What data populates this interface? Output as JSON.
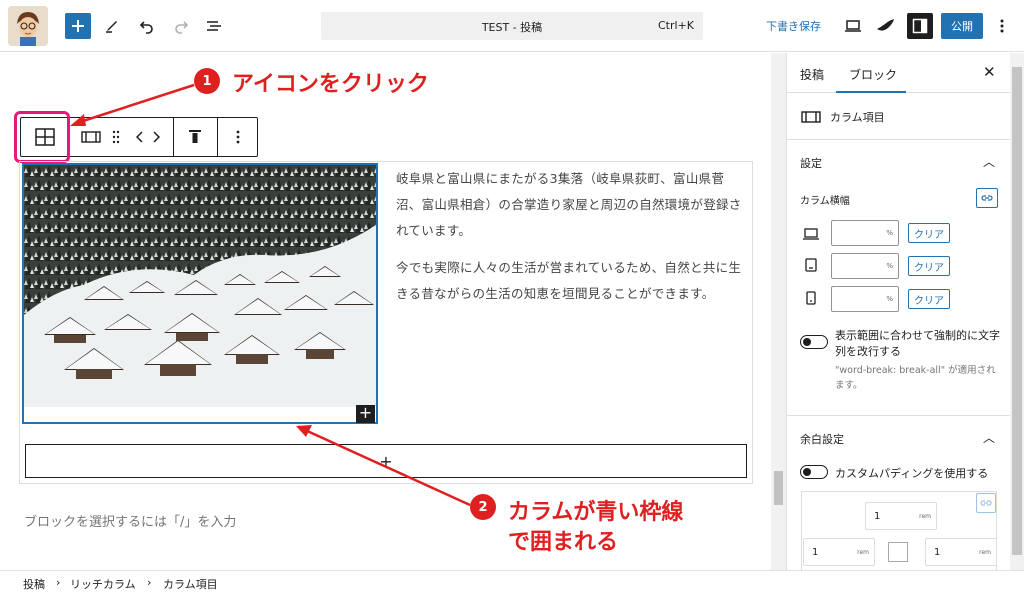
{
  "header": {
    "command_title": "TEST - 投稿",
    "command_shortcut": "Ctrl+K",
    "save_draft": "下書き保存",
    "publish": "公開"
  },
  "content": {
    "paragraph1": "岐阜県と富山県にまたがる3集落（岐阜県荻町、富山県菅沼、富山県相倉）の合掌造り家屋と周辺の自然環境が登録されています。",
    "paragraph2": "今でも実際に人々の生活が営まれているため、自然と共に生きる昔ながらの生活の知恵を垣間見ることができます。",
    "placeholder": "ブロックを選択するには「/」を入力"
  },
  "annotations": {
    "step1_num": "1",
    "step1_text": "アイコンをクリック",
    "step2_num": "2",
    "step2_line1": "カラムが青い枠線",
    "step2_line2": "で囲まれる"
  },
  "sidebar": {
    "tab_post": "投稿",
    "tab_block": "ブロック",
    "block_name": "カラム項目",
    "section_settings": "設定",
    "column_width_label": "カラム横幅",
    "unit": "%",
    "clear": "クリア",
    "toggle_wrap_label": "表示範囲に合わせて強制的に文字列を改行する",
    "toggle_wrap_help": "\"word-break: break-all\" が適用されます。",
    "section_spacing": "余白設定",
    "toggle_padding_label": "カスタムパディングを使用する",
    "pad_value": "1",
    "pad_unit": "rem"
  },
  "breadcrumb": [
    "投稿",
    "リッチカラム",
    "カラム項目"
  ],
  "colors": {
    "accent": "#2271b1",
    "annotation": "#e02020",
    "highlight": "#e4197a"
  }
}
